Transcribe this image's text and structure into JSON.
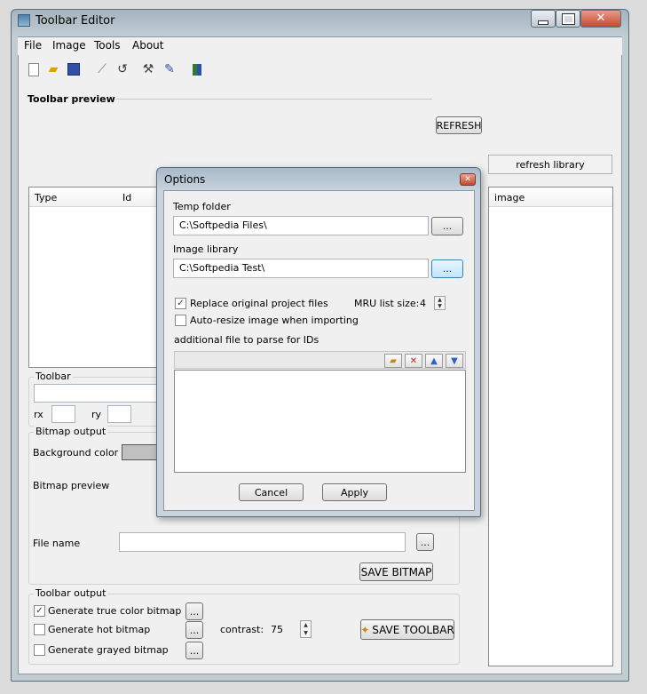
{
  "window": {
    "title": "Toolbar Editor"
  },
  "menu": [
    "File",
    "Image",
    "Tools",
    "About"
  ],
  "toolbar_icons": [
    "new-file-icon",
    "open-folder-icon",
    "save-disk-icon",
    "ruler-icon",
    "undo-icon",
    "wand-icon",
    "edit-icon",
    "export-icon"
  ],
  "preview": {
    "heading": "Toolbar preview",
    "refresh_label": "REFRESH"
  },
  "library": {
    "refresh_label": "refresh library",
    "column": "image"
  },
  "table": {
    "col_type": "Type",
    "col_id": "Id"
  },
  "toolbar_group": {
    "label": "Toolbar",
    "rx_label": "rx",
    "ry_label": "ry"
  },
  "bitmap_output": {
    "label": "Bitmap output",
    "bg_color_label": "Background color",
    "preview_label": "Bitmap preview",
    "file_name_label": "File name",
    "browse_label": "...",
    "save_label": "SAVE BITMAP",
    "bg_color": "#c0c0c0"
  },
  "toolbar_output": {
    "label": "Toolbar output",
    "true_color": {
      "label": "Generate true color bitmap",
      "checked_mark": "✓"
    },
    "hot": {
      "label": "Generate hot bitmap",
      "checked_mark": ""
    },
    "grayed": {
      "label": "Generate grayed bitmap",
      "checked_mark": ""
    },
    "browse_label": "...",
    "contrast_label": "contrast:",
    "contrast_value": "75",
    "save_label": "SAVE TOOLBAR"
  },
  "dialog": {
    "title": "Options",
    "temp_folder_label": "Temp folder",
    "temp_folder_value": "C:\\Softpedia Files\\",
    "image_library_label": "Image library",
    "image_library_value": "C:\\Softpedia Test\\",
    "browse_label": "...",
    "replace_label": "Replace original project files",
    "replace_mark": "✓",
    "autoresize_label": "Auto-resize image when importing",
    "autoresize_mark": "",
    "mru_label": "MRU list size:",
    "mru_value": "4",
    "additional_label": "additional file to parse for IDs",
    "cancel_label": "Cancel",
    "apply_label": "Apply"
  },
  "colors": {
    "accent": "#1a3c8a",
    "close": "#c34a2e"
  }
}
